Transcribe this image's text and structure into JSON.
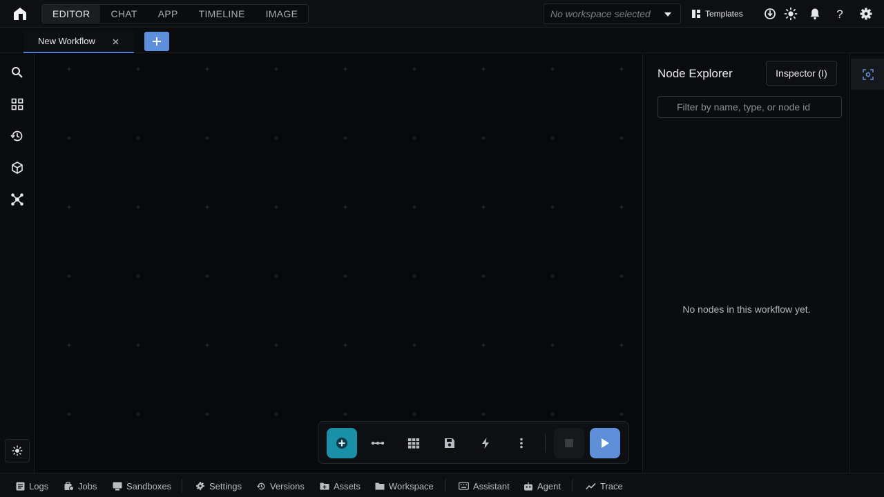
{
  "header": {
    "modes": [
      {
        "label": "EDITOR",
        "active": true
      },
      {
        "label": "CHAT",
        "active": false
      },
      {
        "label": "APP",
        "active": false
      },
      {
        "label": "TIMELINE",
        "active": false
      },
      {
        "label": "IMAGE",
        "active": false
      }
    ],
    "workspace_placeholder": "No workspace selected",
    "templates_label": "Templates",
    "icons": [
      "download-icon",
      "theme-sun-icon",
      "notifications-bell-icon",
      "help-icon",
      "settings-gear-icon"
    ]
  },
  "tabs": {
    "items": [
      {
        "label": "New Workflow",
        "active": true
      }
    ],
    "add_label": "+"
  },
  "sidebar": {
    "icons": [
      "search-icon",
      "grid-icon",
      "history-icon",
      "cube-icon",
      "nodes-network-icon"
    ],
    "theme_toggle": "sun-icon"
  },
  "canvas": {
    "toolbar": [
      "add-node-icon",
      "connect-icon",
      "grid-layout-icon",
      "save-icon",
      "lightning-icon",
      "more-vertical-icon",
      "stop-icon",
      "play-icon"
    ]
  },
  "panel": {
    "title": "Node Explorer",
    "inspector_label": "Inspector (I)",
    "filter_placeholder": "Filter by name, type, or node id",
    "empty_message": "No nodes in this workflow yet."
  },
  "bottombar": {
    "items": [
      {
        "label": "Logs",
        "icon": "logs-icon"
      },
      {
        "label": "Jobs",
        "icon": "jobs-icon"
      },
      {
        "label": "Sandboxes",
        "icon": "sandboxes-icon"
      },
      {
        "label": "Settings",
        "icon": "gear-icon"
      },
      {
        "label": "Versions",
        "icon": "history-icon"
      },
      {
        "label": "Assets",
        "icon": "folder-plus-icon"
      },
      {
        "label": "Workspace",
        "icon": "folder-icon"
      },
      {
        "label": "Assistant",
        "icon": "keyboard-icon"
      },
      {
        "label": "Agent",
        "icon": "robot-icon"
      },
      {
        "label": "Trace",
        "icon": "trend-icon"
      }
    ]
  },
  "colors": {
    "background": "#08090b",
    "accent_blue": "#5f8fd8",
    "accent_teal": "#1a8fa8"
  }
}
